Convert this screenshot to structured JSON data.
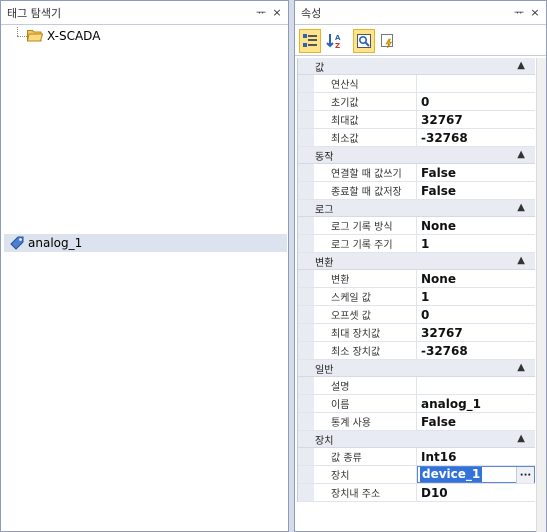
{
  "left_panel": {
    "title": "태그 탐색기",
    "pin": "ᅲ",
    "close": "×",
    "tree_root": "X-SCADA",
    "tag": "analog_1"
  },
  "right_panel": {
    "title": "속성",
    "pin": "ᅲ",
    "close": "×"
  },
  "properties": [
    {
      "category": "값",
      "rows": [
        {
          "name": "연산식",
          "value": ""
        },
        {
          "name": "초기값",
          "value": "0"
        },
        {
          "name": "최대값",
          "value": "32767"
        },
        {
          "name": "최소값",
          "value": "-32768"
        }
      ]
    },
    {
      "category": "동작",
      "rows": [
        {
          "name": "연결할 때 값쓰기",
          "value": "False"
        },
        {
          "name": "종료할 때 값저장",
          "value": "False"
        }
      ]
    },
    {
      "category": "로그",
      "rows": [
        {
          "name": "로그 기록 방식",
          "value": "None"
        },
        {
          "name": "로그 기록 주기",
          "value": "1"
        }
      ]
    },
    {
      "category": "변환",
      "rows": [
        {
          "name": "변환",
          "value": "None"
        },
        {
          "name": "스케일 값",
          "value": "1"
        },
        {
          "name": "오프셋 값",
          "value": "0"
        },
        {
          "name": "최대 장치값",
          "value": "32767"
        },
        {
          "name": "최소 장치값",
          "value": "-32768"
        }
      ]
    },
    {
      "category": "일반",
      "rows": [
        {
          "name": "설명",
          "value": ""
        },
        {
          "name": "이름",
          "value": "analog_1"
        },
        {
          "name": "통계 사용",
          "value": "False"
        }
      ]
    },
    {
      "category": "장치",
      "rows": [
        {
          "name": "값 종류",
          "value": "Int16"
        },
        {
          "name": "장치",
          "value": "device_1",
          "selected": true
        },
        {
          "name": "장치내 주소",
          "value": "D10"
        }
      ]
    }
  ],
  "ellipsis_label": "···",
  "collapse_glyph": "▲"
}
